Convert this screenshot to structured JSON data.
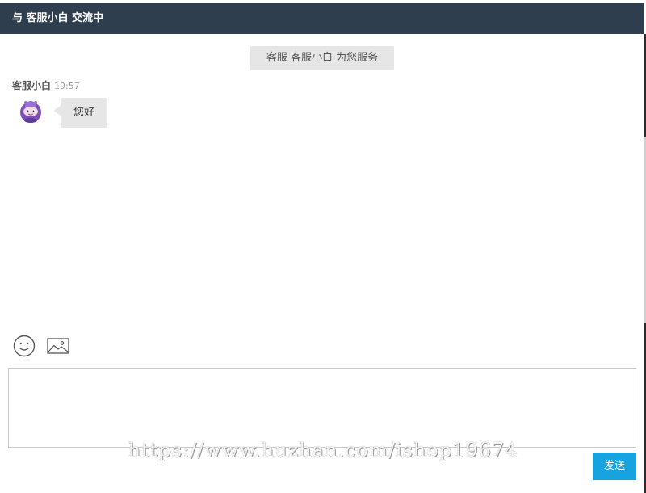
{
  "header": {
    "title": "与 客服小白 交流中"
  },
  "chat": {
    "system_notice": "客服 客服小白 为您服务",
    "messages": [
      {
        "sender": "客服小白",
        "time": "19:57",
        "text": "您好",
        "avatar": "purple-monster-avatar"
      }
    ]
  },
  "toolbar": {
    "emoji_icon": "smiley-face-icon",
    "image_icon": "image-icon"
  },
  "composer": {
    "value": "",
    "send_label": "发送"
  },
  "watermark": "https://www.huzhan.com/ishop19674",
  "colors": {
    "header_bg": "#2e3e4e",
    "bubble_bg": "#e6e6e6",
    "send_button": "#17a2e0"
  }
}
